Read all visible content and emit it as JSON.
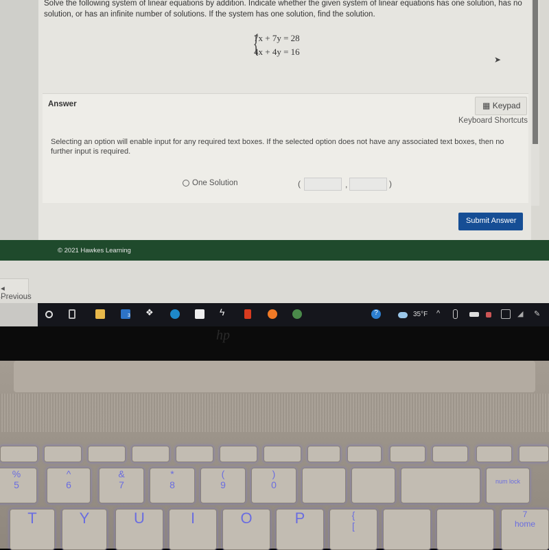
{
  "question": {
    "text": "Solve the following system of linear equations by addition. Indicate whether the given system of linear equations has one solution, has no solution, or has an infinite number of solutions. If the system has one solution, find the solution.",
    "equations": [
      "7x + 7y = 28",
      "4x + 4y = 16"
    ]
  },
  "answer": {
    "label": "Answer",
    "keypad_label": "Keypad",
    "keyboard_shortcuts": "Keyboard Shortcuts",
    "instructions": "Selecting an option will enable input for any required text boxes. If the selected option does not have any associated text boxes, then no further input is required.",
    "option_label": "One Solution",
    "open_paren": "(",
    "comma": ",",
    "close_paren": ")",
    "x_value": "",
    "y_value": ""
  },
  "submit_label": "Submit Answer",
  "footer": {
    "copyright": "© 2021 Hawkes Learning"
  },
  "previous_label": "◂ Previous",
  "taskbar": {
    "temperature": "35°F",
    "mail_badge": "3",
    "icons": [
      "cortana-icon",
      "task-view-icon",
      "file-explorer-icon",
      "mail-icon",
      "dropbox-icon",
      "edge-icon",
      "store-icon",
      "app-icon",
      "office-icon",
      "firefox-icon",
      "chrome-icon",
      "help-icon",
      "weather-icon",
      "chevron-up-icon",
      "network-icon",
      "battery-icon",
      "volume-icon",
      "notification-icon"
    ]
  },
  "laptop": {
    "logo": "hp",
    "keys": [
      "%\n5",
      "^\n6",
      "&\n7",
      "*\n8",
      "(\n9",
      ")\n0",
      "num lock",
      "T",
      "Y",
      "U",
      "I",
      "O",
      "P",
      "{\n[",
      "7\nhome"
    ]
  },
  "colors": {
    "footer": "#1f4a2c",
    "submit": "#164e95",
    "taskbar": "#15161c"
  }
}
